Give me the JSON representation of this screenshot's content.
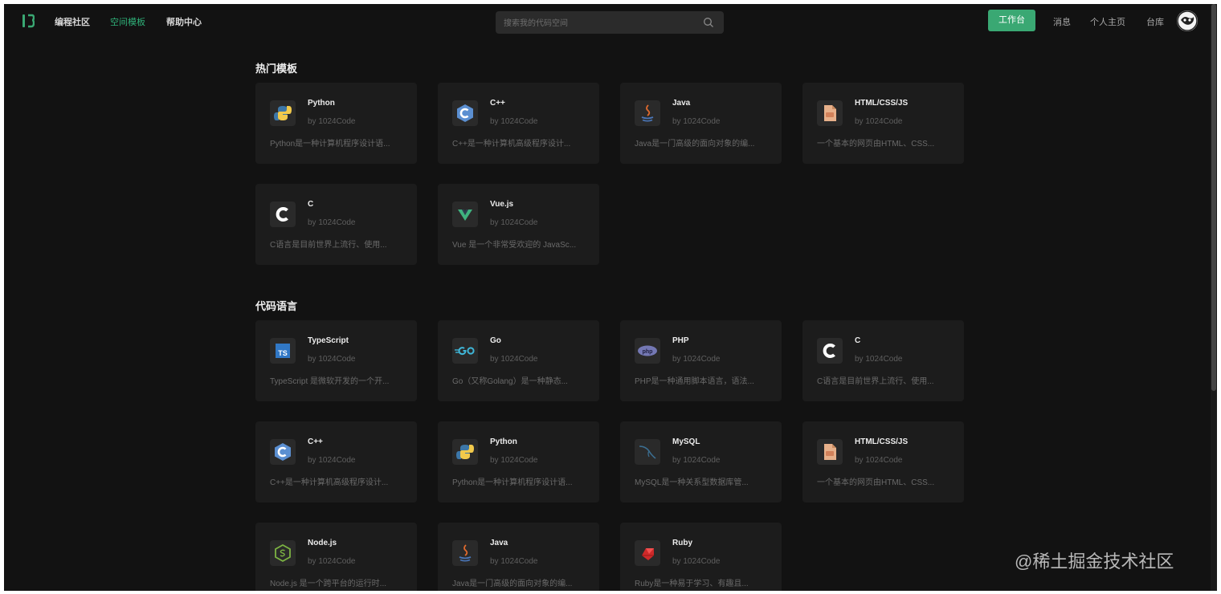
{
  "nav": {
    "links": [
      "编程社区",
      "空间模板",
      "帮助中心"
    ],
    "search_placeholder": "搜索我的代码空间",
    "workspace_button": "工作台",
    "right_links": [
      "消息",
      "个人主页",
      "台库"
    ]
  },
  "sections": {
    "hot": {
      "title": "热门模板",
      "cards": [
        {
          "name": "Python",
          "author": "by 1024Code",
          "desc": "Python是一种计算机程序设计语...",
          "icon": "python-icon"
        },
        {
          "name": "C++",
          "author": "by 1024Code",
          "desc": "C++是一种计算机高级程序设计...",
          "icon": "cpp-icon"
        },
        {
          "name": "Java",
          "author": "by 1024Code",
          "desc": "Java是一门高级的面向对象的编...",
          "icon": "java-icon"
        },
        {
          "name": "HTML/CSS/JS",
          "author": "by 1024Code",
          "desc": "一个基本的网页由HTML、CSS...",
          "icon": "html-file-icon"
        },
        {
          "name": "C",
          "author": "by 1024Code",
          "desc": "C语言是目前世界上流行、使用...",
          "icon": "c-icon"
        },
        {
          "name": "Vue.js",
          "author": "by 1024Code",
          "desc": "Vue 是一个非常受欢迎的 JavaSc...",
          "icon": "vue-icon"
        }
      ]
    },
    "languages": {
      "title": "代码语言",
      "cards": [
        {
          "name": "TypeScript",
          "author": "by 1024Code",
          "desc": "TypeScript 是微软开发的一个开...",
          "icon": "typescript-icon"
        },
        {
          "name": "Go",
          "author": "by 1024Code",
          "desc": "Go（又称Golang）是一种静态...",
          "icon": "go-icon"
        },
        {
          "name": "PHP",
          "author": "by 1024Code",
          "desc": "PHP是一种通用脚本语言，语法...",
          "icon": "php-icon"
        },
        {
          "name": "C",
          "author": "by 1024Code",
          "desc": "C语言是目前世界上流行、使用...",
          "icon": "c-icon"
        },
        {
          "name": "C++",
          "author": "by 1024Code",
          "desc": "C++是一种计算机高级程序设计...",
          "icon": "cpp-icon"
        },
        {
          "name": "Python",
          "author": "by 1024Code",
          "desc": "Python是一种计算机程序设计语...",
          "icon": "python-icon"
        },
        {
          "name": "MySQL",
          "author": "by 1024Code",
          "desc": "MySQL是一种关系型数据库管...",
          "icon": "mysql-icon"
        },
        {
          "name": "HTML/CSS/JS",
          "author": "by 1024Code",
          "desc": "一个基本的网页由HTML、CSS...",
          "icon": "html-file-icon"
        },
        {
          "name": "Node.js",
          "author": "by 1024Code",
          "desc": "Node.js 是一个跨平台的运行时...",
          "icon": "nodejs-icon"
        },
        {
          "name": "Java",
          "author": "by 1024Code",
          "desc": "Java是一门高级的面向对象的编...",
          "icon": "java-icon"
        },
        {
          "name": "Ruby",
          "author": "by 1024Code",
          "desc": "Ruby是一种易于学习、有趣且...",
          "icon": "ruby-icon"
        }
      ]
    }
  },
  "watermark": "@稀土掘金技术社区",
  "colors": {
    "background": "#121212",
    "card": "#1c1c1c",
    "accent": "#3aa873",
    "active_link": "#2fb179"
  }
}
